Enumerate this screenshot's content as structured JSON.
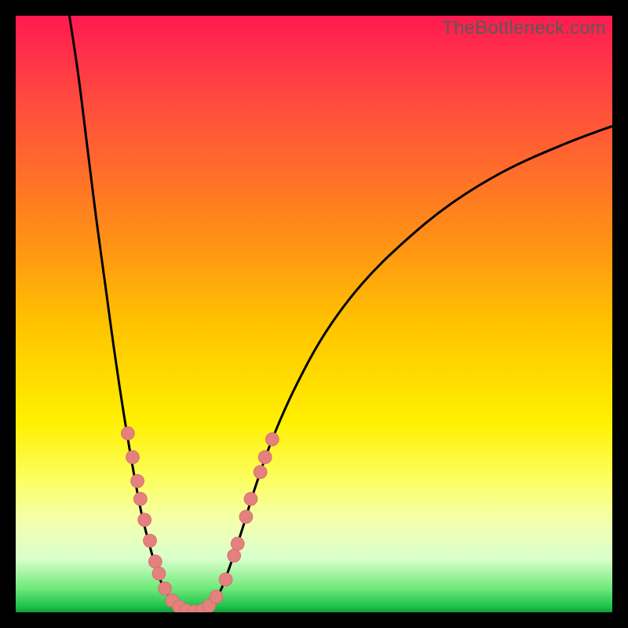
{
  "watermark": "TheBottleneck.com",
  "chart_data": {
    "type": "line",
    "title": "",
    "xlabel": "",
    "ylabel": "",
    "xlim": [
      0,
      100
    ],
    "ylim": [
      0,
      100
    ],
    "grid": false,
    "background": "rainbow-gradient",
    "notes": "Chart has no visible axis ticks or labels. Axes are implied by the black frame. Values below are coordinates in the 0–100 plot space estimated from the geometry of the curves and markers.",
    "series": [
      {
        "name": "valley-curve-left",
        "stroke": "#000000",
        "points": [
          {
            "x": 9.0,
            "y": 100.0
          },
          {
            "x": 10.5,
            "y": 90.0
          },
          {
            "x": 12.0,
            "y": 78.0
          },
          {
            "x": 13.5,
            "y": 66.0
          },
          {
            "x": 15.0,
            "y": 55.0
          },
          {
            "x": 16.5,
            "y": 44.0
          },
          {
            "x": 18.0,
            "y": 34.0
          },
          {
            "x": 19.5,
            "y": 25.0
          },
          {
            "x": 21.0,
            "y": 17.0
          },
          {
            "x": 22.5,
            "y": 11.0
          },
          {
            "x": 24.0,
            "y": 6.0
          },
          {
            "x": 25.5,
            "y": 3.0
          },
          {
            "x": 27.0,
            "y": 1.2
          },
          {
            "x": 28.5,
            "y": 0.3
          },
          {
            "x": 30.0,
            "y": 0.0
          }
        ]
      },
      {
        "name": "valley-curve-right",
        "stroke": "#000000",
        "points": [
          {
            "x": 30.0,
            "y": 0.0
          },
          {
            "x": 31.5,
            "y": 0.3
          },
          {
            "x": 33.0,
            "y": 1.5
          },
          {
            "x": 34.5,
            "y": 4.0
          },
          {
            "x": 36.0,
            "y": 8.0
          },
          {
            "x": 38.0,
            "y": 14.0
          },
          {
            "x": 40.0,
            "y": 20.5
          },
          {
            "x": 43.0,
            "y": 29.0
          },
          {
            "x": 47.0,
            "y": 38.0
          },
          {
            "x": 52.0,
            "y": 47.0
          },
          {
            "x": 58.0,
            "y": 55.0
          },
          {
            "x": 65.0,
            "y": 62.0
          },
          {
            "x": 73.0,
            "y": 68.5
          },
          {
            "x": 82.0,
            "y": 74.0
          },
          {
            "x": 92.0,
            "y": 78.5
          },
          {
            "x": 100.0,
            "y": 81.5
          }
        ]
      }
    ],
    "markers": {
      "name": "dot-cluster",
      "color": "#e4817f",
      "radius": 1.1,
      "points": [
        {
          "x": 18.8,
          "y": 30.0
        },
        {
          "x": 19.6,
          "y": 26.0
        },
        {
          "x": 20.4,
          "y": 22.0
        },
        {
          "x": 20.9,
          "y": 19.0
        },
        {
          "x": 21.6,
          "y": 15.5
        },
        {
          "x": 22.5,
          "y": 12.0
        },
        {
          "x": 23.4,
          "y": 8.5
        },
        {
          "x": 24.0,
          "y": 6.5
        },
        {
          "x": 25.0,
          "y": 4.0
        },
        {
          "x": 26.2,
          "y": 2.0
        },
        {
          "x": 27.4,
          "y": 0.9
        },
        {
          "x": 28.6,
          "y": 0.3
        },
        {
          "x": 30.0,
          "y": 0.1
        },
        {
          "x": 31.2,
          "y": 0.3
        },
        {
          "x": 32.4,
          "y": 1.1
        },
        {
          "x": 33.6,
          "y": 2.6
        },
        {
          "x": 35.2,
          "y": 5.5
        },
        {
          "x": 36.6,
          "y": 9.5
        },
        {
          "x": 37.2,
          "y": 11.5
        },
        {
          "x": 38.6,
          "y": 16.0
        },
        {
          "x": 39.4,
          "y": 19.0
        },
        {
          "x": 41.0,
          "y": 23.5
        },
        {
          "x": 41.8,
          "y": 26.0
        },
        {
          "x": 43.0,
          "y": 29.0
        }
      ]
    }
  }
}
